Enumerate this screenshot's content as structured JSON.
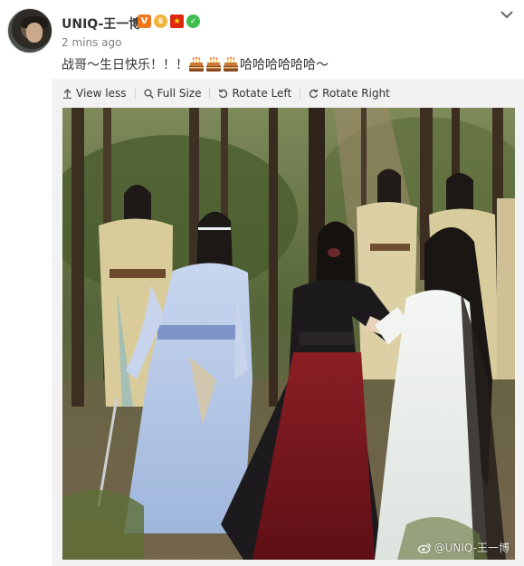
{
  "post": {
    "username": "UNIQ-王一博",
    "timestamp": "2 mins ago",
    "text": "战哥～生日快乐！！！",
    "text_suffix": "哈哈哈哈哈哈～",
    "emoji_count": 3,
    "badges": [
      "verified-v-icon",
      "crown-icon",
      "china-flag-icon",
      "vip-check-icon"
    ]
  },
  "toolbar": {
    "view_less": "View less",
    "full_size": "Full Size",
    "rotate_left": "Rotate Left",
    "rotate_right": "Rotate Right"
  },
  "photo": {
    "watermark": "@UNIQ-王一博"
  },
  "colors": {
    "badge_v": "#f0761a",
    "badge_crown": "#f3b23c",
    "badge_flag": "#de2910",
    "badge_check": "#3fbd4e",
    "media_bg": "#f2f2f2"
  }
}
